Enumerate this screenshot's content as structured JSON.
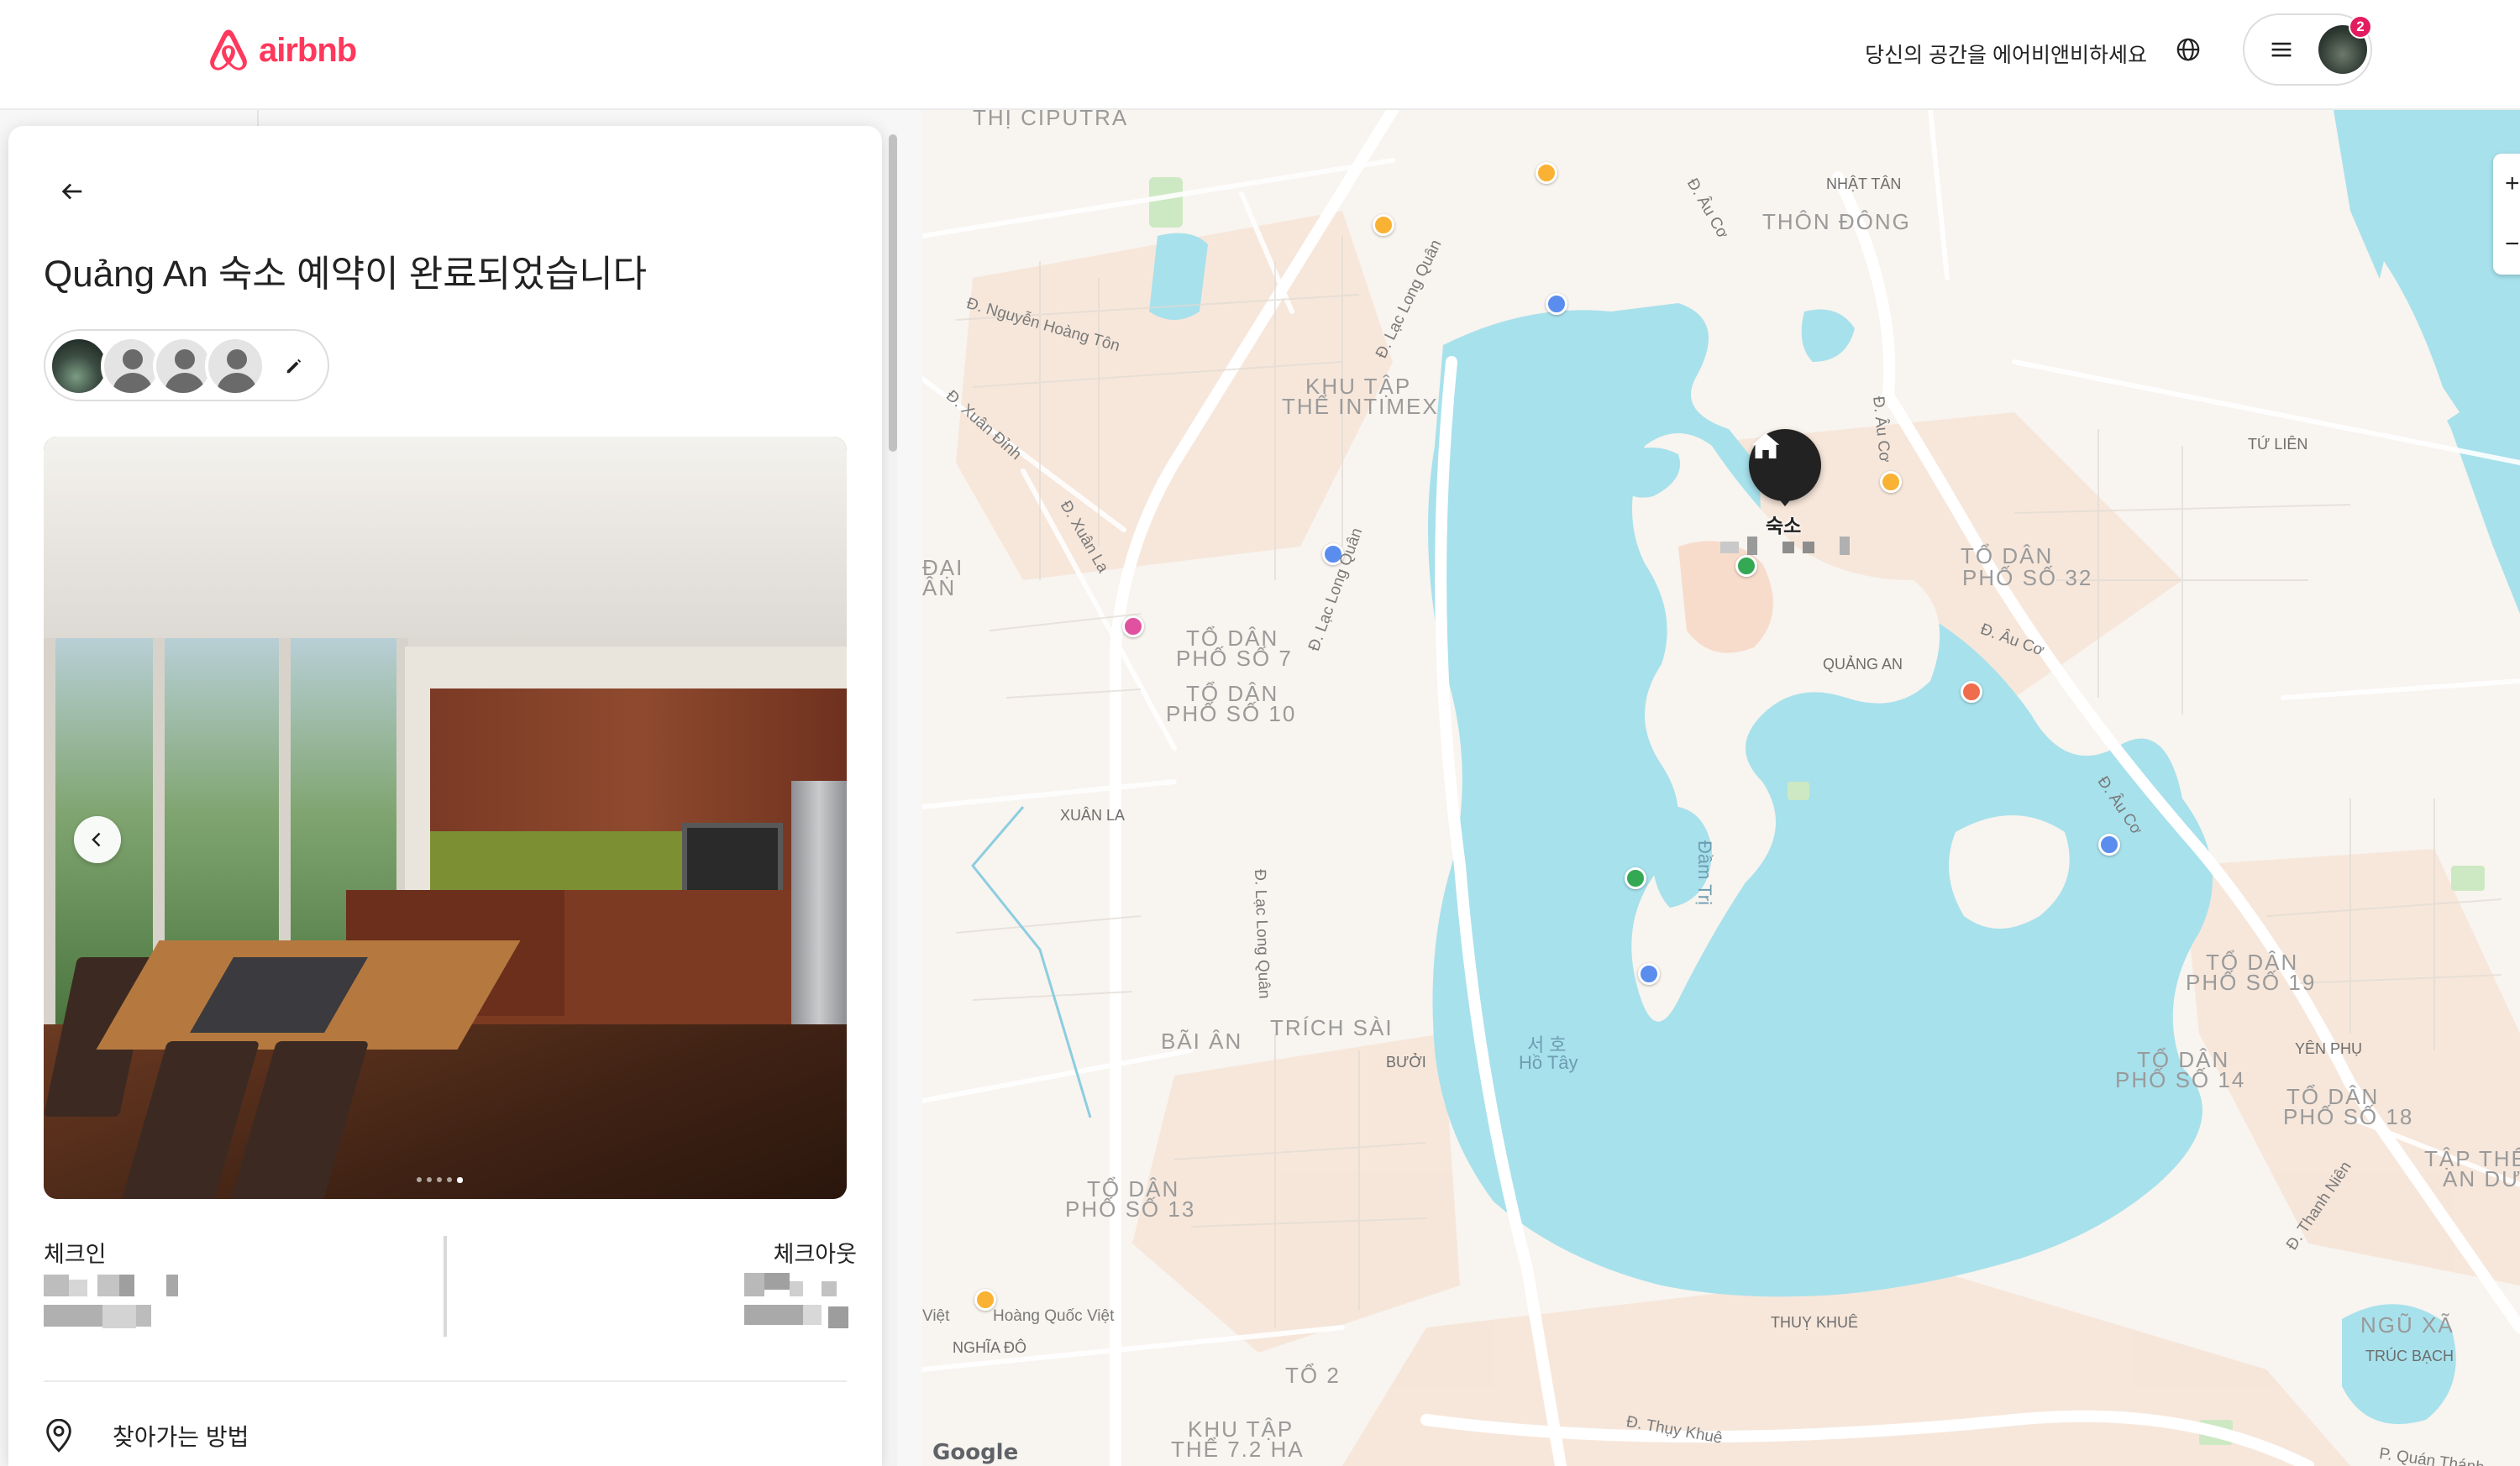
{
  "header": {
    "brand": "airbnb",
    "host_link": "당신의 공간을 에어비앤비하세요",
    "notification_count": "2",
    "icons": {
      "logo": "airbnb-logo",
      "globe": "globe-icon",
      "menu": "menu-icon"
    }
  },
  "panel": {
    "title": "Quảng An 숙소 예약이 완료되었습니다",
    "checkin_label": "체크인",
    "checkout_label": "체크아웃",
    "directions_label": "찾아가는 방법",
    "photo_count": 5,
    "photo_active_index": 4
  },
  "map": {
    "pin_label": "숙소",
    "labels": {
      "nhat_tan": "NHẬT TÂN",
      "thon_dong": "THÔN ĐÔNG",
      "thi_ciputra": "THỊ CIPUTRA",
      "khu_tap_the_intimex_1": "KHU TẬP",
      "khu_tap_the_intimex_2": "THỂ INTIMEX",
      "tu_lien": "TỨ LIÊN",
      "to_dan_32_1": "TỔ DÂN",
      "to_dan_32_2": "PHỐ SỐ 32",
      "quang_an": "QUẢNG AN",
      "xuan_la": "XUÂN LA",
      "to_dan_a_1": "TỔ DÂN",
      "to_dan_a_2": "PHỐ SỐ 7",
      "to_dan_b_1": "TỔ DÂN",
      "to_dan_b_2": "PHỐ SỐ 10",
      "dai_an_1": "ĐẠI",
      "dai_an_2": "ÂN",
      "to_dan_19_1": "TỔ DÂN",
      "to_dan_19_2": "PHỐ SỐ 19",
      "yen_phu": "YÊN PHỤ",
      "to_dan_14_1": "TỔ DÂN",
      "to_dan_14_2": "PHỐ SỐ 14",
      "to_dan_18_1": "TỔ DÂN",
      "to_dan_18_2": "PHỐ SỐ 18",
      "tap_the_an_1": "TẬP THỂ",
      "tap_the_an_2": "AN DƯ",
      "bai_an": "BÃI ÂN",
      "trich_sai": "TRÍCH SÀI",
      "buoi": "BƯỞI",
      "ho_tay_1": "서 호",
      "ho_tay_2": "Hồ Tây",
      "dam_tri": "Đầm Trị",
      "to_dan_13_1": "TỔ DÂN",
      "to_dan_13_2": "PHỐ SỐ 13",
      "thuy_khue": "THUỴ KHUÊ",
      "nghia_do": "NGHĨA ĐÔ",
      "ngu_xa": "NGŨ XÃ",
      "truc_bach": "TRÚC BẠCH",
      "to_2": "TỔ 2",
      "khu_tap_the_72_1": "KHU TẬP",
      "khu_tap_the_72_2": "THỂ 7.2 HA",
      "viet": "Việt",
      "hoang_quoc_viet": "Hoàng Quốc Việt"
    },
    "roads": {
      "nguyen_hoang_ton": "Đ. Nguyễn Hoàng Tôn",
      "xuan_dinh": "Đ. Xuân Đỉnh",
      "lac_long_quan_top": "Đ. Lạc Long Quân",
      "xuan_la": "Đ. Xuân La",
      "lac_long_quan_mid": "Đ. Lạc Long Quân",
      "lac_long_quan_low": "Đ. Lạc Long Quân",
      "au_co_top": "Đ. Âu Cơ",
      "au_co_mid": "Đ. Âu Cơ",
      "au_co_right": "Đ. Âu Cơ",
      "au_co_far": "Đ. Âu Cơ",
      "thanh_nien": "Đ. Thanh Niên",
      "thuy_khue": "Đ. Thụy Khuê",
      "quan_thanh": "P. Quán Thánh"
    },
    "attribution": "Google",
    "zoom_in": "+",
    "zoom_out": "−"
  },
  "colors": {
    "brand": "#FF385C",
    "water": "#a7e1ec",
    "land": "#f8f4ef",
    "urban": "#f7dccb",
    "park": "#cde9c3"
  }
}
